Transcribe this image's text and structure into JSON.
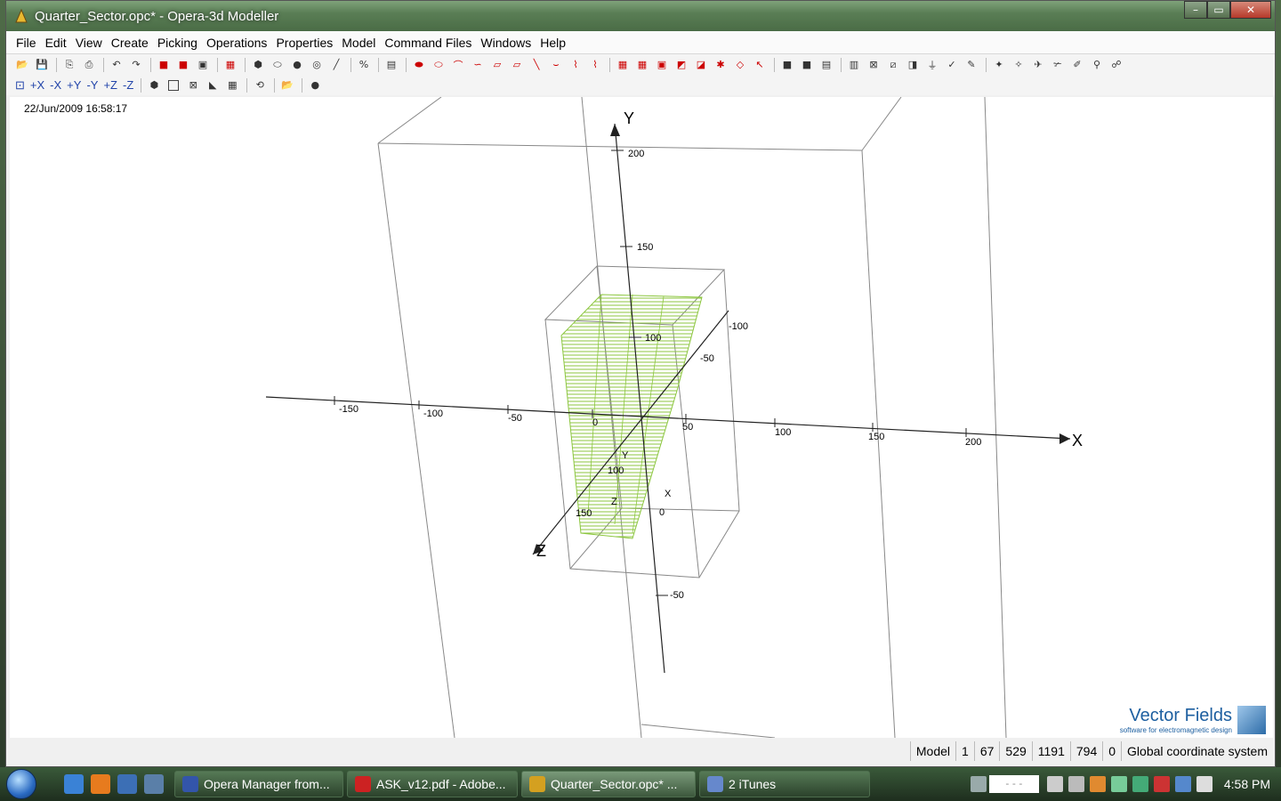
{
  "window": {
    "title": "Quarter_Sector.opc* - Opera-3d Modeller",
    "minimize": "–",
    "maximize": "▭",
    "close": "✕"
  },
  "menu": [
    "File",
    "Edit",
    "View",
    "Create",
    "Picking",
    "Operations",
    "Properties",
    "Model",
    "Command Files",
    "Windows",
    "Help"
  ],
  "toolbar2": {
    "view_labels": [
      "+X",
      "-X",
      "+Y",
      "-Y",
      "+Z",
      "-Z"
    ]
  },
  "viewport": {
    "timestamp": "22/Jun/2009 16:58:17",
    "axes": {
      "x_label": "X",
      "y_label": "Y",
      "z_label": "Z",
      "x_ticks": [
        "-150",
        "-100",
        "-50",
        "0",
        "50",
        "100",
        "150",
        "200"
      ],
      "y_ticks": [
        "200",
        "150",
        "100",
        "-50"
      ],
      "z_ticks": [
        "100",
        "150"
      ],
      "inner_labels": [
        "-100",
        "-50",
        "0",
        "Y",
        "Z",
        "X"
      ]
    },
    "logo": {
      "name": "Vector Fields",
      "tagline": "software for electromagnetic design"
    }
  },
  "statusbar": {
    "mode": "Model",
    "v1": "1",
    "v2": "67",
    "v3": "529",
    "v4": "1191",
    "v5": "794",
    "v6": "0",
    "coords": "Global coordinate system"
  },
  "taskbar": {
    "tasks": [
      {
        "label": "Opera Manager from...",
        "color": "#3355aa"
      },
      {
        "label": "ASK_v12.pdf - Adobe...",
        "color": "#cc2222"
      },
      {
        "label": "Quarter_Sector.opc* ...",
        "color": "#d4a020"
      },
      {
        "label": "2 iTunes",
        "color": "#6688cc"
      }
    ],
    "tray_field": "- - -",
    "clock": "4:58 PM"
  },
  "colors": {
    "accent": "#1d5fa0",
    "mesh": "#8cc63f",
    "axis": "#222222"
  }
}
